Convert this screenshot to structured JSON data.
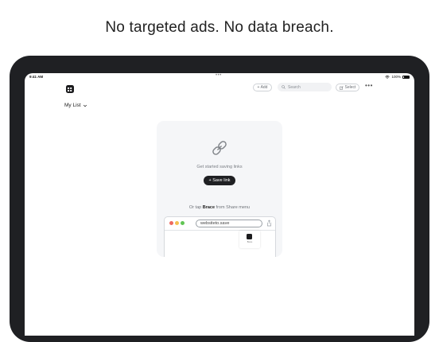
{
  "headline": "No targeted ads. No data breach.",
  "status_bar": {
    "time": "9:41 AM",
    "center": "•••",
    "battery": "100%"
  },
  "toolbar": {
    "add_label": "+ Add",
    "search_placeholder": "Search",
    "select_label": "Select",
    "more": "•••"
  },
  "list_selector": {
    "label": "My List"
  },
  "empty_state": {
    "message": "Get started saving links",
    "save_button": "+ Save link",
    "tap_prefix": "Or tap ",
    "tap_app": "Brace",
    "tap_suffix": " from Share menu"
  },
  "browser_demo": {
    "url": "websiteto.save",
    "menu_item_label": "Brace"
  },
  "colors": {
    "dark": "#1f2023",
    "card_bg": "#f5f6f8",
    "red": "#ee6a5f",
    "yellow": "#f5c04f",
    "green": "#61c554"
  }
}
